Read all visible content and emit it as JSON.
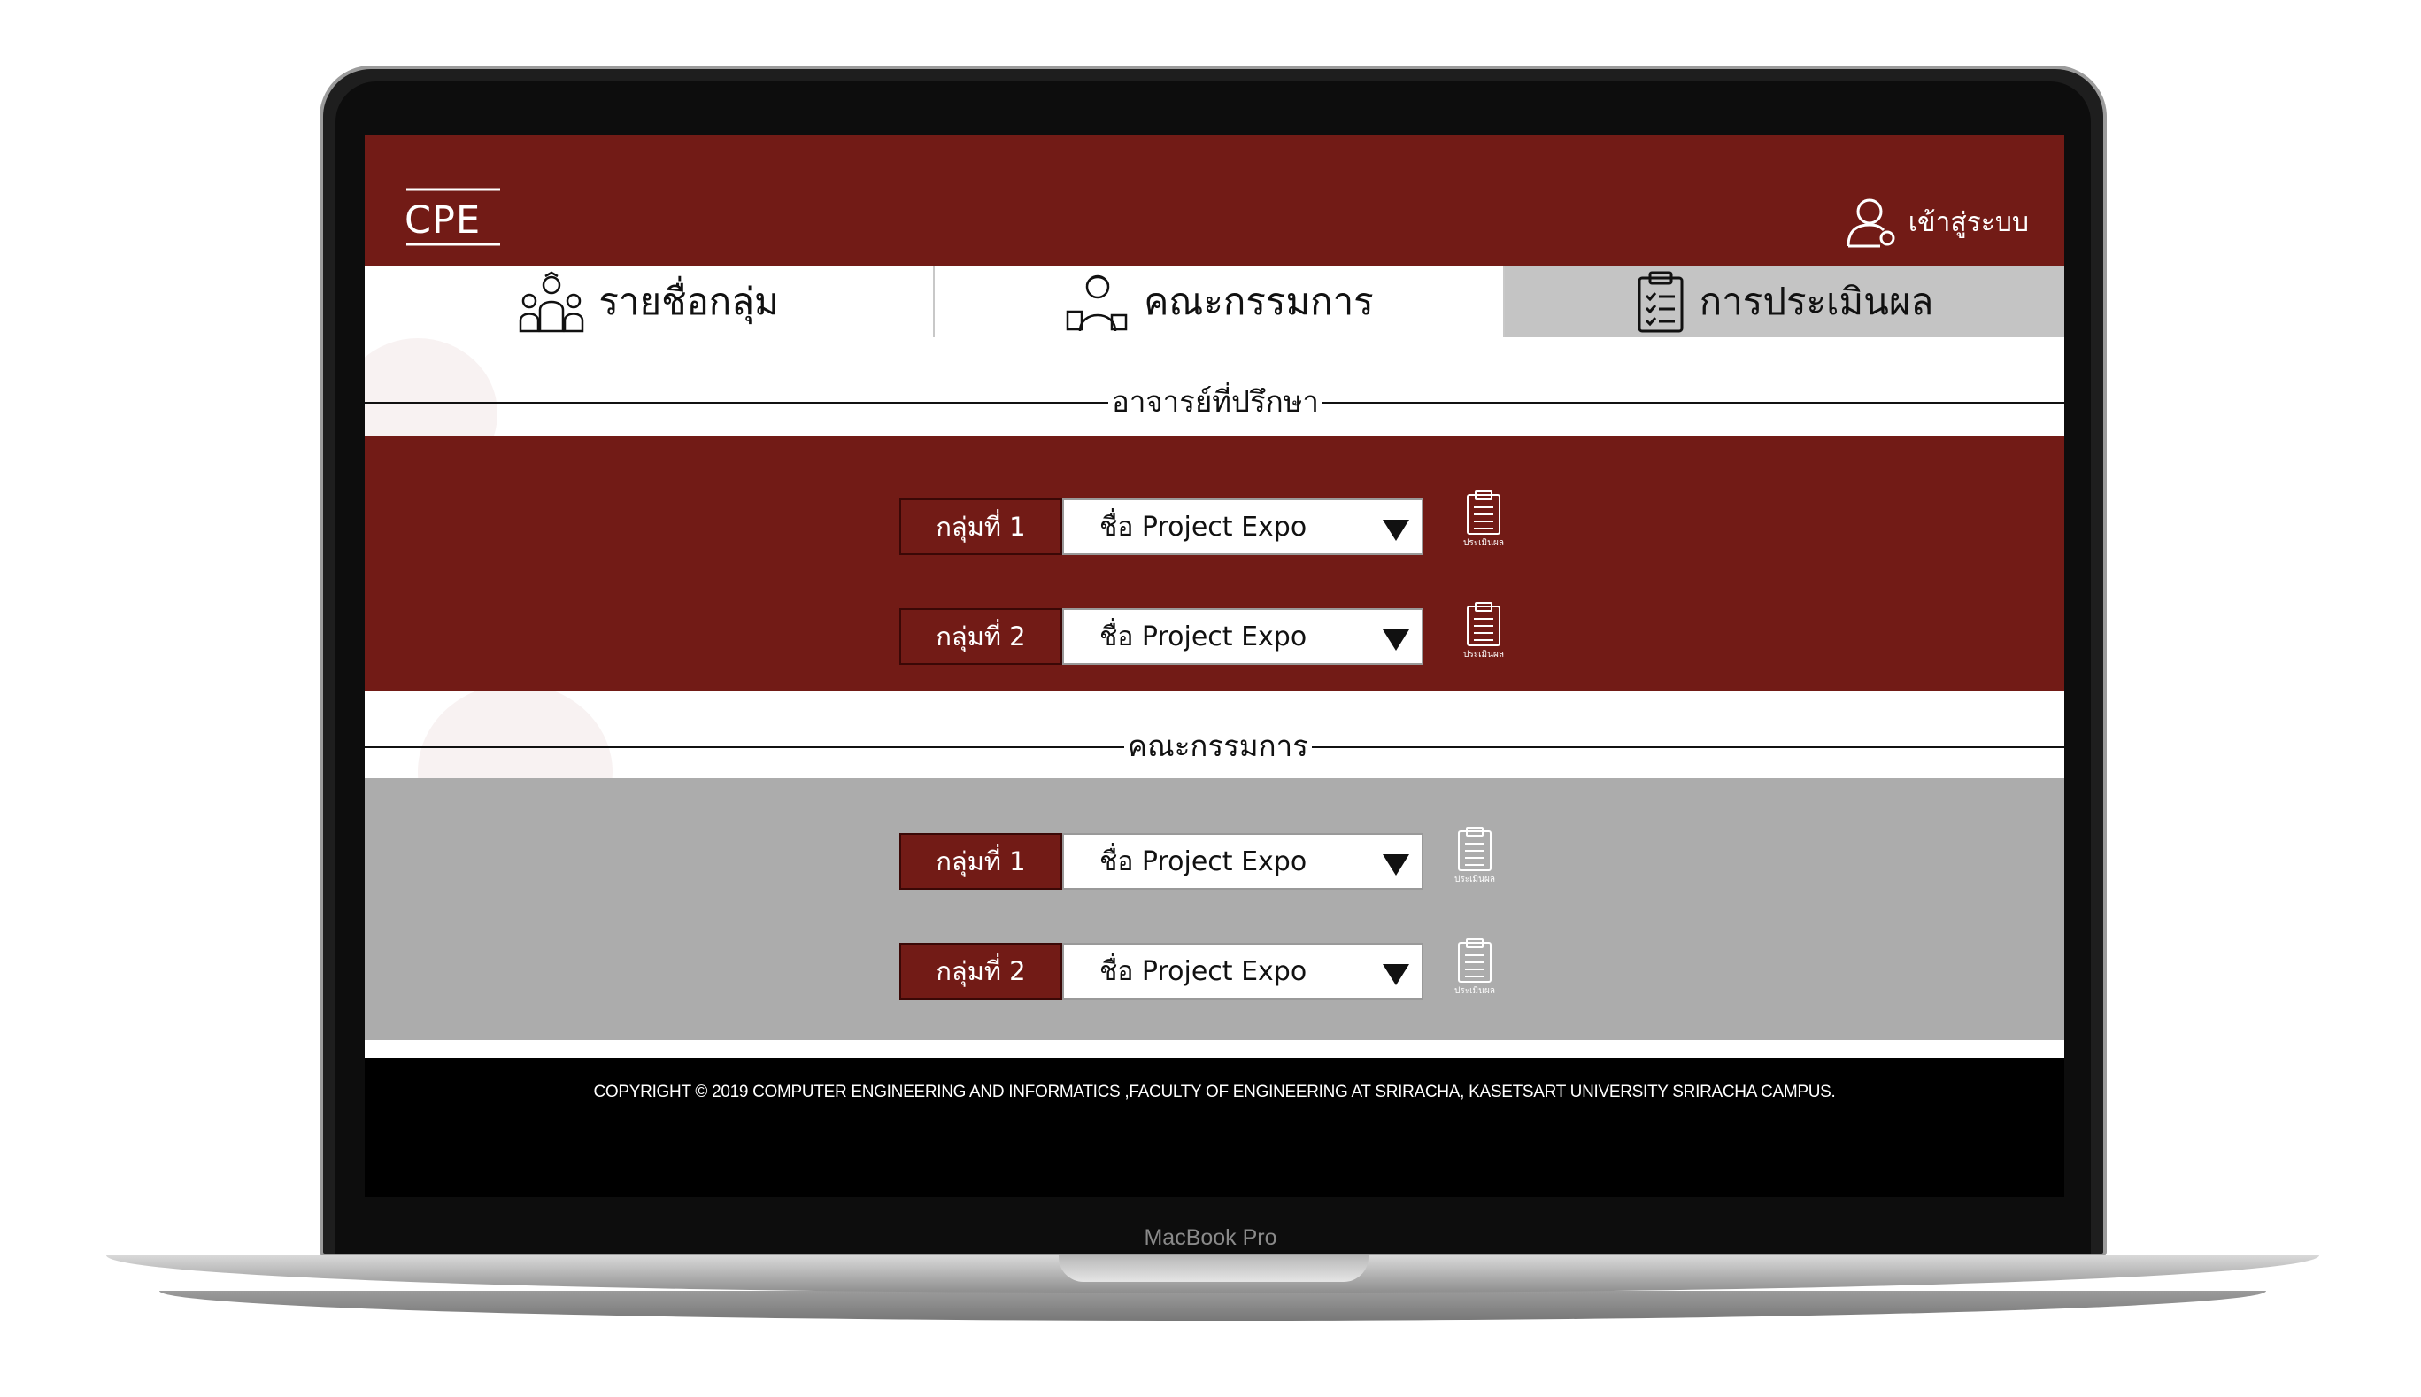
{
  "device": {
    "label": "MacBook Pro"
  },
  "header": {
    "logo": "CPE",
    "login_label": "เข้าสู่ระบบ"
  },
  "tabs": [
    {
      "label": "รายชื่อกลุ่ม",
      "icon": "group-people-icon",
      "active": false
    },
    {
      "label": "คณะกรรมการ",
      "icon": "committee-person-icon",
      "active": false
    },
    {
      "label": "การประเมินผล",
      "icon": "clipboard-icon",
      "active": true
    }
  ],
  "advisor_section": {
    "title": "อาจารย์ที่ปรึกษา",
    "rows": [
      {
        "group": "กลุ่มที่ 1",
        "project": "ชื่อ Project Expo",
        "eval_label": "ประเมินผล"
      },
      {
        "group": "กลุ่มที่ 2",
        "project": "ชื่อ Project Expo",
        "eval_label": "ประเมินผล"
      }
    ]
  },
  "committee_section": {
    "title": "คณะกรรมการ",
    "rows": [
      {
        "group": "กลุ่มที่ 1",
        "project": "ชื่อ Project Expo",
        "eval_label": "ประเมินผล"
      },
      {
        "group": "กลุ่มที่ 2",
        "project": "ชื่อ Project Expo",
        "eval_label": "ประเมินผล"
      }
    ]
  },
  "footer": {
    "copyright": "COPYRIGHT © 2019 COMPUTER ENGINEERING AND INFORMATICS ,FACULTY OF ENGINEERING AT SRIRACHA, KASETSART UNIVERSITY SRIRACHA CAMPUS."
  },
  "colors": {
    "brand_red": "#721b16",
    "gray_band": "#acacac",
    "active_tab": "#c4c4c4"
  }
}
